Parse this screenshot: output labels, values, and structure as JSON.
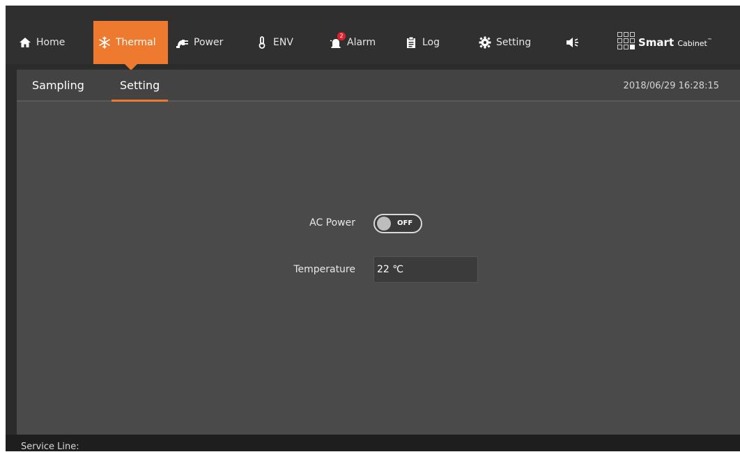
{
  "nav": {
    "items": [
      {
        "label": "Home",
        "icon": "home-icon"
      },
      {
        "label": "Thermal",
        "icon": "snowflake-icon"
      },
      {
        "label": "Power",
        "icon": "power-plug-icon"
      },
      {
        "label": "ENV",
        "icon": "thermometer-icon"
      },
      {
        "label": "Alarm",
        "icon": "alarm-icon",
        "badge": "2"
      },
      {
        "label": "Log",
        "icon": "clipboard-icon"
      },
      {
        "label": "Setting",
        "icon": "gear-icon"
      },
      {
        "label": "",
        "icon": "speaker-icon"
      }
    ],
    "active": "Thermal"
  },
  "logo": {
    "brand": "Smart",
    "suffix": "Cabinet",
    "tm": "™"
  },
  "subtabs": [
    {
      "label": "Sampling"
    },
    {
      "label": "Setting"
    }
  ],
  "datetime": "2018/06/29 16:28:15",
  "form": {
    "ac_power_label": "AC Power",
    "ac_power_state": "OFF",
    "temperature_label": "Temperature",
    "temperature_value": "22 ℃"
  },
  "footer": {
    "service_line": "Service Line:"
  },
  "colors": {
    "accent": "#ee7a2f",
    "nav_bg": "#303030",
    "content_bg": "#4a4a4a",
    "badge": "#e0202a"
  }
}
